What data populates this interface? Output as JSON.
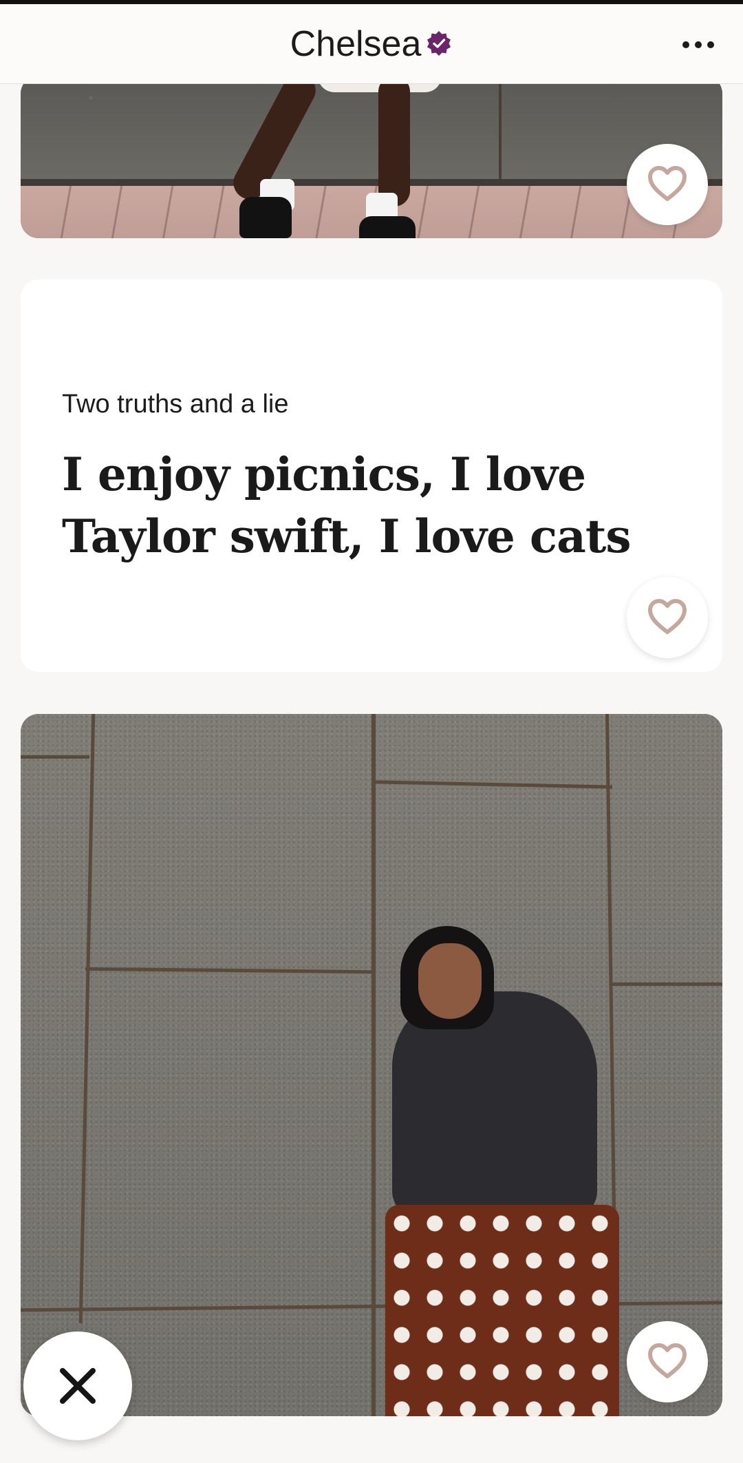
{
  "header": {
    "title": "Chelsea",
    "verified_icon": "verified-badge-icon",
    "more_icon": "more-options-icon",
    "verified_color": "#6b2369"
  },
  "cards": [
    {
      "type": "photo",
      "like_icon": "heart-icon"
    },
    {
      "type": "prompt",
      "label": "Two truths and a lie",
      "answer": "I enjoy picnics, I love Taylor swift, I love cats",
      "like_icon": "heart-icon"
    },
    {
      "type": "photo",
      "like_icon": "heart-icon"
    }
  ],
  "actions": {
    "skip_icon": "close-x-icon"
  },
  "colors": {
    "heart": "#c4a89e",
    "text": "#1a1a1a",
    "background": "#f8f7f5"
  }
}
